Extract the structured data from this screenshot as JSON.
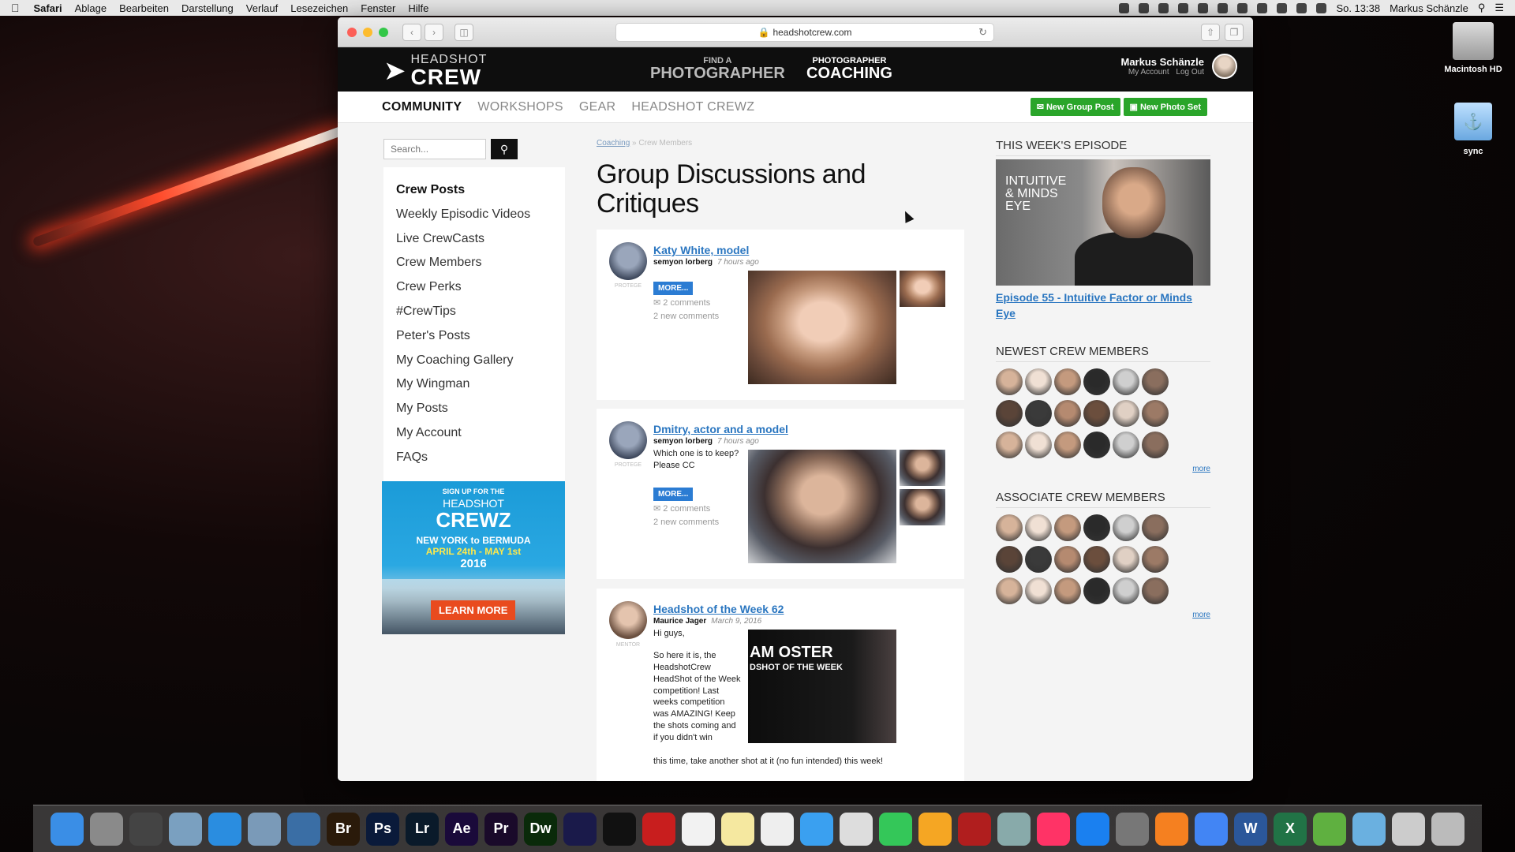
{
  "menubar": {
    "app": "Safari",
    "items": [
      "Ablage",
      "Bearbeiten",
      "Darstellung",
      "Verlauf",
      "Lesezeichen",
      "Fenster",
      "Hilfe"
    ],
    "clock": "So. 13:38",
    "user": "Markus Schänzle"
  },
  "desktop": {
    "hd_label": "Macintosh HD",
    "sync_label": "sync"
  },
  "browser": {
    "url": "headshotcrew.com"
  },
  "site": {
    "logo_top": "HEADSHOT",
    "logo_bottom": "CREW",
    "nav_find_small": "FIND A",
    "nav_find_big": "PHOTOGRAPHER",
    "nav_coach_small": "PHOTOGRAPHER",
    "nav_coach_big": "COACHING",
    "user_name": "Markus Schänzle",
    "my_account": "My Account",
    "log_out": "Log Out"
  },
  "subnav": {
    "items": [
      "COMMUNITY",
      "WORKSHOPS",
      "GEAR",
      "HEADSHOT CREWZ"
    ],
    "new_group_post": "New Group Post",
    "new_photo_set": "New Photo Set"
  },
  "sidebar": {
    "search_placeholder": "Search...",
    "items": [
      "Crew Posts",
      "Weekly Episodic Videos",
      "Live CrewCasts",
      "Crew Members",
      "Crew Perks",
      "#CrewTips",
      "Peter's Posts",
      "My Coaching Gallery",
      "My Wingman",
      "My Posts",
      "My Account",
      "FAQs"
    ]
  },
  "ad": {
    "line1": "SIGN UP FOR THE",
    "line2": "HEADSHOT",
    "line3": "CREWZ",
    "line4": "NEW YORK to BERMUDA",
    "line5": "APRIL 24th - MAY 1st",
    "line6": "2016",
    "cta": "LEARN MORE"
  },
  "main": {
    "breadcrumb_root": "Coaching",
    "breadcrumb_sep": "»",
    "breadcrumb_current": "Crew Members",
    "title": "Group Discussions and Critiques",
    "posts": [
      {
        "title": "Katy White, model",
        "author": "semyon lorberg",
        "time": "7 hours ago",
        "role": "PROTEGE",
        "text": "",
        "more": "MORE...",
        "comments": "2 comments",
        "new_comments": "2 new comments"
      },
      {
        "title": "Dmitry, actor and a model",
        "author": "semyon lorberg",
        "time": "7 hours ago",
        "role": "PROTEGE",
        "text": "Which one is to keep? Please CC",
        "more": "MORE...",
        "comments": "2 comments",
        "new_comments": "2 new comments"
      },
      {
        "title": "Headshot of the Week 62",
        "author": "Maurice Jager",
        "time": "March 9, 2016",
        "role": "MENTOR",
        "text_1": "Hi guys,",
        "text_2": "So here it is, the HeadshotCrew HeadShot of the Week competition! Last weeks competition was AMAZING! Keep the shots coming and if you didn't win",
        "text_3": "this time, take another shot at it (no fun intended) this week!",
        "img_line1": "AM OSTER",
        "img_line2": "DSHOT OF THE WEEK"
      }
    ]
  },
  "right": {
    "episode_title": "THIS WEEK'S EPISODE",
    "episode_img_text": "INTUITIVE & MINDS EYE",
    "episode_link": "Episode 55 - Intuitive Factor or Minds Eye",
    "newest_title": "NEWEST CREW MEMBERS",
    "associate_title": "ASSOCIATE CREW MEMBERS",
    "more": "more"
  },
  "dock": {
    "icons": [
      "finder-icon",
      "launchpad-icon",
      "mission-control-icon",
      "preview-icon",
      "safari-icon",
      "mail-icon",
      "1password-icon",
      "Br",
      "Ps",
      "Lr",
      "Ae",
      "Pr",
      "Dw",
      "media-encoder-icon",
      "terminal-icon",
      "filezilla-icon",
      "calendar-icon",
      "notes-icon",
      "reminders-icon",
      "messages-icon",
      "preview2-icon",
      "facetime-icon",
      "photos-icon",
      "photo-booth-icon",
      "image-capture-icon",
      "itunes-icon",
      "app-store-icon",
      "system-preferences-icon",
      "vlc-icon",
      "chrome-icon",
      "W",
      "X",
      "evernote-icon",
      "folder-icon",
      "brushes-icon",
      "trash-icon"
    ]
  }
}
